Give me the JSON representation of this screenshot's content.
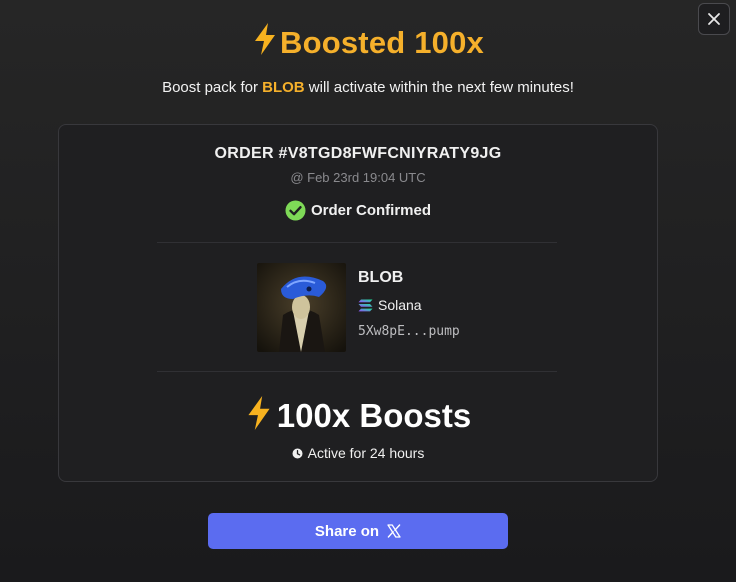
{
  "header": {
    "title": "Boosted 100x",
    "subtitle_prefix": "Boost pack for ",
    "subtitle_token": "BLOB",
    "subtitle_suffix": " will activate within the next few minutes!",
    "close_icon": "close-icon"
  },
  "order": {
    "id_label": "ORDER #V8TGD8FWFCNIYRATY9JG",
    "timestamp": "@ Feb 23rd 19:04 UTC",
    "status": "Order Confirmed",
    "status_icon": "check-circle-icon",
    "status_color": "#7ed957"
  },
  "token": {
    "name": "BLOB",
    "chain": "Solana",
    "chain_icon": "solana-icon",
    "address": "5Xw8pE...pump",
    "image": "token-avatar"
  },
  "boost": {
    "label": "100x Boosts",
    "duration": "Active for 24 hours",
    "bolt_icon": "lightning-bolt-icon",
    "clock_icon": "clock-icon"
  },
  "share": {
    "label": "Share on",
    "icon": "x-logo-icon",
    "color": "#5b6cf0"
  },
  "colors": {
    "accent": "#f5b02b",
    "background": "#1f1f21"
  }
}
